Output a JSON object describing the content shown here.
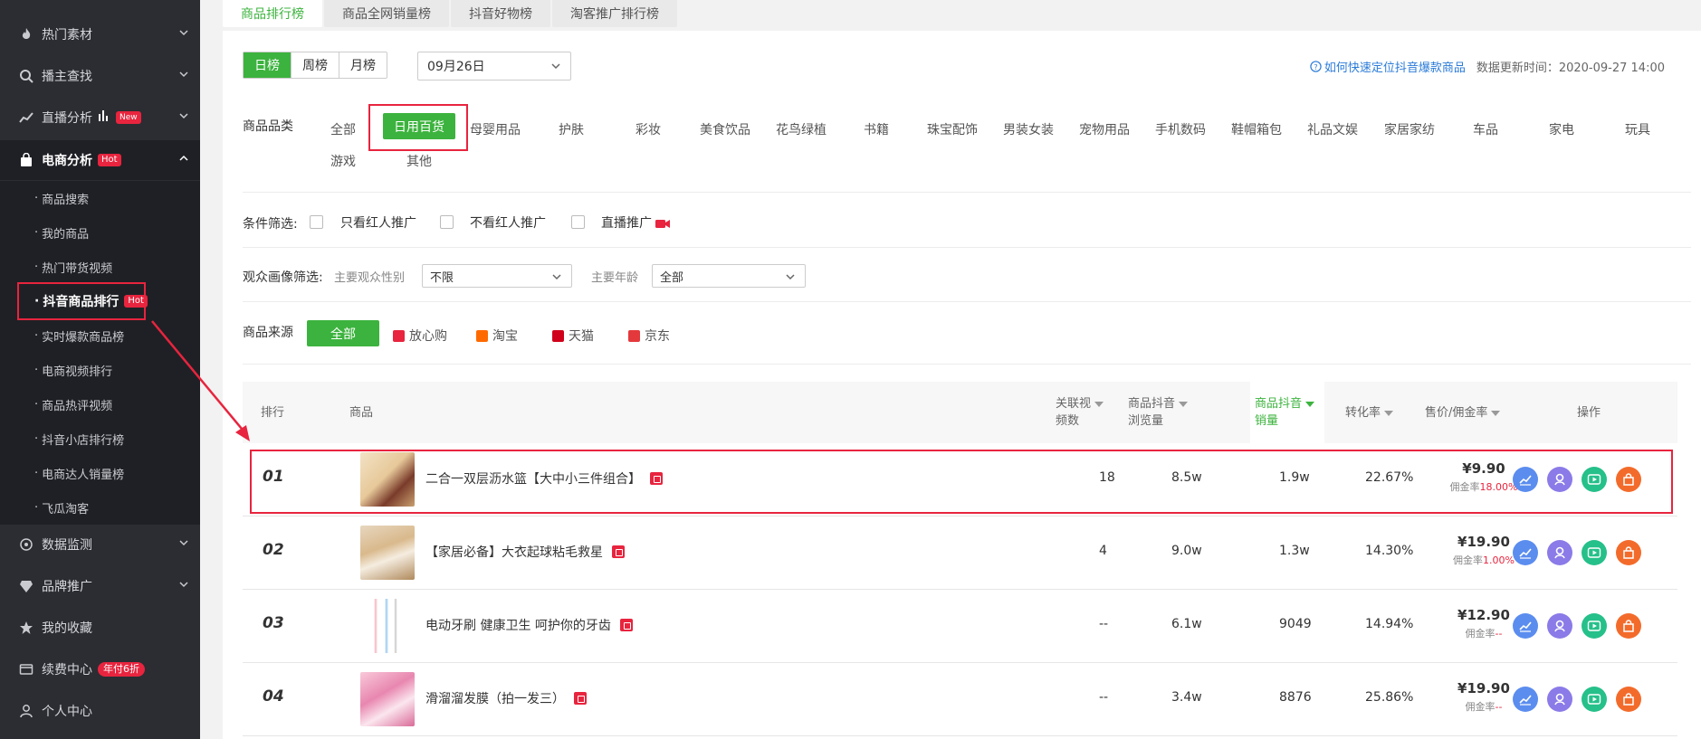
{
  "sidebar": {
    "items": [
      {
        "label": "热门素材"
      },
      {
        "label": "播主查找"
      },
      {
        "label": "直播分析",
        "badge": "New"
      },
      {
        "label": "电商分析",
        "badge": "Hot"
      },
      {
        "label": "数据监测"
      },
      {
        "label": "品牌推广"
      },
      {
        "label": "我的收藏"
      },
      {
        "label": "续费中心",
        "badge": "年付6折"
      },
      {
        "label": "个人中心"
      }
    ],
    "subitems": [
      {
        "label": "商品搜索"
      },
      {
        "label": "我的商品"
      },
      {
        "label": "热门带货视频"
      },
      {
        "label": "抖音商品排行",
        "badge": "Hot"
      },
      {
        "label": "实时爆款商品榜"
      },
      {
        "label": "电商视频排行"
      },
      {
        "label": "商品热评视频"
      },
      {
        "label": "抖音小店排行榜"
      },
      {
        "label": "电商达人销量榜"
      },
      {
        "label": "飞瓜淘客"
      }
    ]
  },
  "tabs": [
    "商品排行榜",
    "商品全网销量榜",
    "抖音好物榜",
    "淘客推广排行榜"
  ],
  "period": {
    "options": [
      "日榜",
      "周榜",
      "月榜"
    ],
    "selected": "日榜"
  },
  "date": "09月26日",
  "help": {
    "link": "如何快速定位抖音爆款商品",
    "updated": "数据更新时间：2020-09-27 14:00"
  },
  "category": {
    "label": "商品品类",
    "items": [
      "全部",
      "日用百货",
      "母婴用品",
      "护肤",
      "彩妆",
      "美食饮品",
      "花鸟绿植",
      "书籍",
      "珠宝配饰",
      "男装女装",
      "宠物用品",
      "手机数码",
      "鞋帽箱包",
      "礼品文娱",
      "家居家纺",
      "车品",
      "家电",
      "玩具",
      "游戏",
      "其他"
    ],
    "selected": "日用百货"
  },
  "conditions": {
    "label": "条件筛选:",
    "options": [
      "只看红人推广",
      "不看红人推广",
      "直播推广"
    ]
  },
  "audience": {
    "label": "观众画像筛选:",
    "gender_label": "主要观众性别",
    "gender_value": "不限",
    "age_label": "主要年龄",
    "age_value": "全部"
  },
  "source": {
    "label": "商品来源",
    "selected": "全部",
    "options": [
      "放心购",
      "淘宝",
      "天猫",
      "京东"
    ]
  },
  "table": {
    "headers": {
      "rank": "排行",
      "product": "商品",
      "videos": [
        "关联视",
        "频数"
      ],
      "views": [
        "商品抖音",
        "浏览量"
      ],
      "sales": [
        "商品抖音",
        "销量"
      ],
      "conv": "转化率",
      "price": "售价/佣金率",
      "ops": "操作"
    },
    "rows": [
      {
        "rank": "01",
        "name": "二合一双层沥水篮【大中小三件组合】",
        "videos": "18",
        "views": "8.5w",
        "sales": "1.9w",
        "conv": "22.67%",
        "price": "¥9.90",
        "commission_label": "佣金率",
        "commission": "18.00%"
      },
      {
        "rank": "02",
        "name": "【家居必备】大衣起球粘毛救星",
        "videos": "4",
        "views": "9.0w",
        "sales": "1.3w",
        "conv": "14.30%",
        "price": "¥19.90",
        "commission_label": "佣金率",
        "commission": "1.00%"
      },
      {
        "rank": "03",
        "name": "电动牙刷 健康卫生 呵护你的牙齿",
        "videos": "--",
        "views": "6.1w",
        "sales": "9049",
        "conv": "14.94%",
        "price": "¥12.90",
        "commission_label": "佣金率",
        "commission": "--"
      },
      {
        "rank": "04",
        "name": "滑溜溜发膜（拍一发三）",
        "videos": "--",
        "views": "3.4w",
        "sales": "8876",
        "conv": "25.86%",
        "price": "¥19.90",
        "commission_label": "佣金率",
        "commission": "--"
      }
    ]
  },
  "colors": {
    "accent": "#3cb33e",
    "highlight_border": "#e8243e",
    "sidebar_bg": "#2b2d33"
  },
  "icons": {
    "ops": [
      "trend-chart-icon",
      "influencer-icon",
      "video-play-icon",
      "shop-icon"
    ]
  }
}
